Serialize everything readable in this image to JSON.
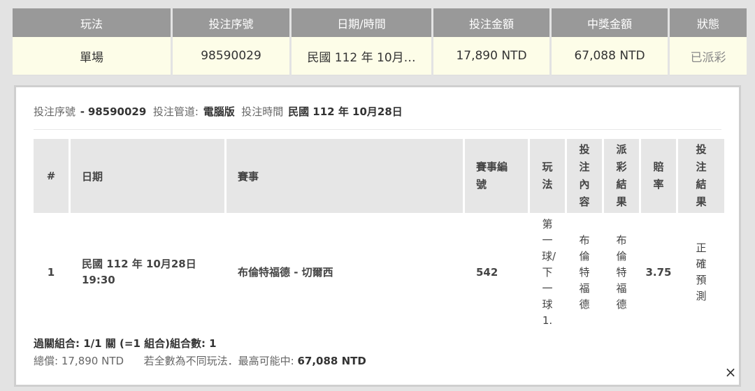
{
  "summary": {
    "headers": [
      "玩法",
      "投注序號",
      "日期/時間",
      "投注金額",
      "中獎金額",
      "狀態"
    ],
    "row": {
      "play": "單場",
      "serial": "98590029",
      "datetime": "民國 112 年 10月…",
      "stake": "17,890 NTD",
      "prize": "67,088 NTD",
      "status": "已派彩"
    }
  },
  "detail": {
    "info": {
      "serial_label": "投注序號",
      "serial_sep": "-",
      "serial_value": "98590029",
      "channel_label": "投注管道:",
      "channel_value": "電腦版",
      "time_label": "投注時間",
      "time_value": "民國 112 年 10月28日"
    },
    "columns": [
      "#",
      "日期",
      "賽事",
      "賽事編號",
      "玩法",
      "投注內容",
      "派彩結果",
      "賠率",
      "投注結果"
    ],
    "rows": [
      {
        "index": "1",
        "date": "民國 112 年 10月28日",
        "time": "19:30",
        "match": "布倫特福德 - 切爾西",
        "match_no": "542",
        "play": "第一球/下一球1.",
        "pick": "布倫特福德",
        "result": "布倫特福德",
        "odds": "3.75",
        "outcome": "正確預測"
      }
    ],
    "footer": {
      "combo": "過關組合: 1/1 關 (=1 組合)組合數: 1",
      "total_label": "總償:",
      "total_value": "17,890 NTD",
      "max_label": "若全數為不同玩法．最高可能中:",
      "max_value": "67,088 NTD"
    }
  },
  "close_icon": "×",
  "colors": {
    "header_bg": "#999999",
    "row_bg": "#fdfde8",
    "detail_header_bg": "#e6e6e6"
  }
}
